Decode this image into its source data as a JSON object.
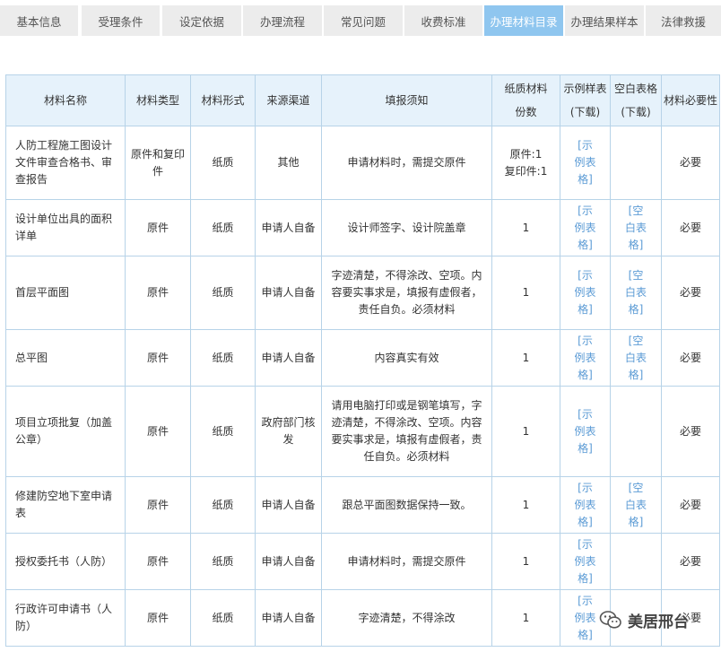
{
  "tabs": [
    {
      "label": "基本信息",
      "active": false
    },
    {
      "label": "受理条件",
      "active": false
    },
    {
      "label": "设定依据",
      "active": false
    },
    {
      "label": "办理流程",
      "active": false
    },
    {
      "label": "常见问题",
      "active": false
    },
    {
      "label": "收费标准",
      "active": false
    },
    {
      "label": "办理材料目录",
      "active": true
    },
    {
      "label": "办理结果样本",
      "active": false
    },
    {
      "label": "法律救援",
      "active": false
    }
  ],
  "table": {
    "headers": {
      "name": "材料名称",
      "type": "材料类型",
      "form": "材料形式",
      "source": "来源渠道",
      "notes": "填报须知",
      "copies": "纸质材料份数",
      "sample_line1": "示例样表",
      "sample_line2": "(下载)",
      "blank_line1": "空白表格",
      "blank_line2": "(下载)",
      "necessity": "材料必要性"
    },
    "rows": [
      {
        "name": "人防工程施工图设计文件审查合格书、审查报告",
        "type": "原件和复印件",
        "form": "纸质",
        "source": "其他",
        "notes": "申请材料时，需提交原件",
        "copies_line1": "原件:1",
        "copies_line2": "复印件:1",
        "sample": "[示例表格]",
        "blank": "",
        "necessity": "必要"
      },
      {
        "name": "设计单位出具的面积详单",
        "type": "原件",
        "form": "纸质",
        "source": "申请人自备",
        "notes": "设计师签字、设计院盖章",
        "copies_line1": "1",
        "copies_line2": "",
        "sample": "[示例表格]",
        "blank": "[空白表格]",
        "necessity": "必要"
      },
      {
        "name": "首层平面图",
        "type": "原件",
        "form": "纸质",
        "source": "申请人自备",
        "notes": "字迹清楚，不得涂改、空项。内容要实事求是，填报有虚假者，责任自负。必须材料",
        "copies_line1": "1",
        "copies_line2": "",
        "sample": "[示例表格]",
        "blank": "[空白表格]",
        "necessity": "必要"
      },
      {
        "name": "总平图",
        "type": "原件",
        "form": "纸质",
        "source": "申请人自备",
        "notes": "内容真实有效",
        "copies_line1": "1",
        "copies_line2": "",
        "sample": "[示例表格]",
        "blank": "[空白表格]",
        "necessity": "必要"
      },
      {
        "name": "项目立项批复（加盖公章）",
        "type": "原件",
        "form": "纸质",
        "source": "政府部门核发",
        "notes": "请用电脑打印或是钢笔填写，字迹清楚，不得涂改、空项。内容要实事求是，填报有虚假者，责任自负。必须材料",
        "copies_line1": "1",
        "copies_line2": "",
        "sample": "[示例表格]",
        "blank": "",
        "necessity": "必要"
      },
      {
        "name": "修建防空地下室申请表",
        "type": "原件",
        "form": "纸质",
        "source": "申请人自备",
        "notes": "跟总平面图数据保持一致。",
        "copies_line1": "1",
        "copies_line2": "",
        "sample": "[示例表格]",
        "blank": "[空白表格]",
        "necessity": "必要"
      },
      {
        "name": "授权委托书（人防）",
        "type": "原件",
        "form": "纸质",
        "source": "申请人自备",
        "notes": "申请材料时，需提交原件",
        "copies_line1": "1",
        "copies_line2": "",
        "sample": "[示例表格]",
        "blank": "",
        "necessity": "必要"
      },
      {
        "name": "行政许可申请书（人防）",
        "type": "原件",
        "form": "纸质",
        "source": "申请人自备",
        "notes": "字迹清楚，不得涂改",
        "copies_line1": "1",
        "copies_line2": "",
        "sample": "[示例表格]",
        "blank": "",
        "necessity": "必要"
      }
    ]
  },
  "watermark": {
    "text": "美居邢台"
  }
}
